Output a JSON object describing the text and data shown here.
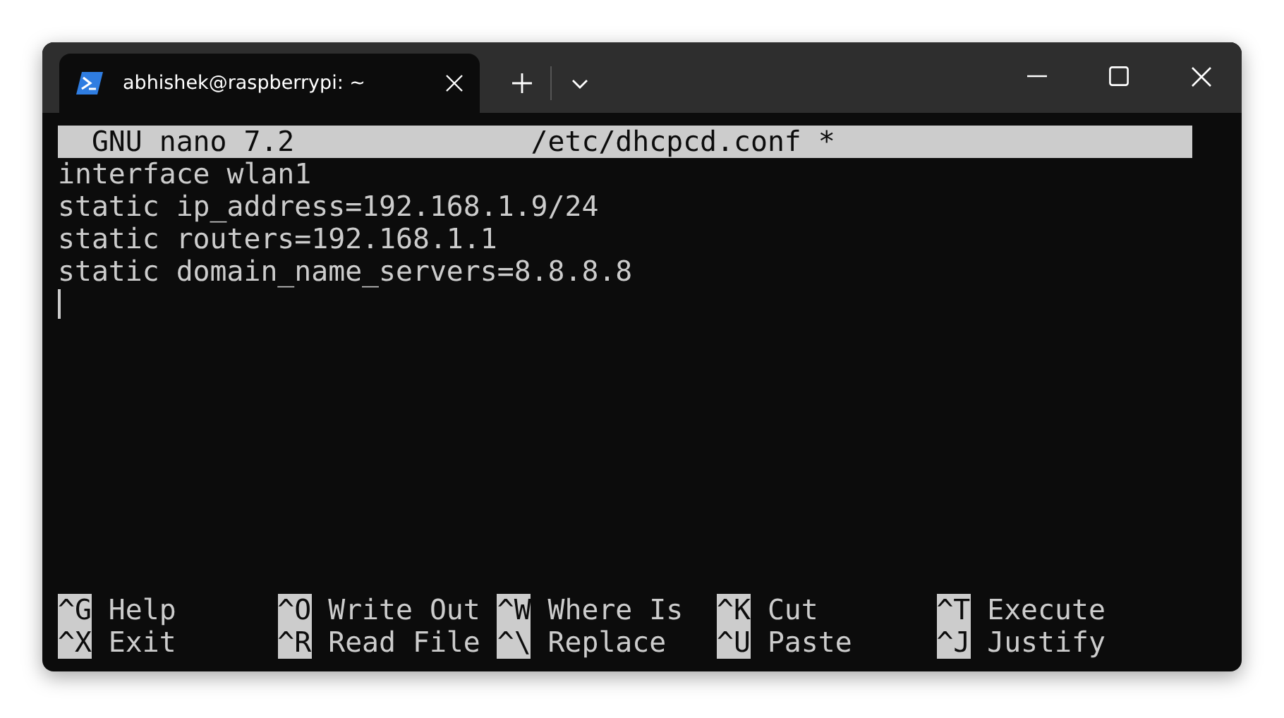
{
  "window": {
    "tabs": [
      {
        "title": "abhishek@raspberrypi: ~",
        "selected": true
      }
    ]
  },
  "editor": {
    "header": {
      "program": "GNU nano 7.2",
      "file": "/etc/dhcpcd.conf *"
    },
    "lines": [
      "interface wlan1",
      "static ip_address=192.168.1.9/24",
      "static routers=192.168.1.1",
      "static domain_name_servers=8.8.8.8"
    ],
    "shortcut_rows": [
      [
        {
          "key": "^G",
          "label": "Help"
        },
        {
          "key": "^O",
          "label": "Write Out"
        },
        {
          "key": "^W",
          "label": "Where Is"
        },
        {
          "key": "^K",
          "label": "Cut"
        },
        {
          "key": "^T",
          "label": "Execute"
        }
      ],
      [
        {
          "key": "^X",
          "label": "Exit"
        },
        {
          "key": "^R",
          "label": "Read File"
        },
        {
          "key": "^\\",
          "label": "Replace"
        },
        {
          "key": "^U",
          "label": "Paste"
        },
        {
          "key": "^J",
          "label": "Justify"
        }
      ]
    ]
  }
}
